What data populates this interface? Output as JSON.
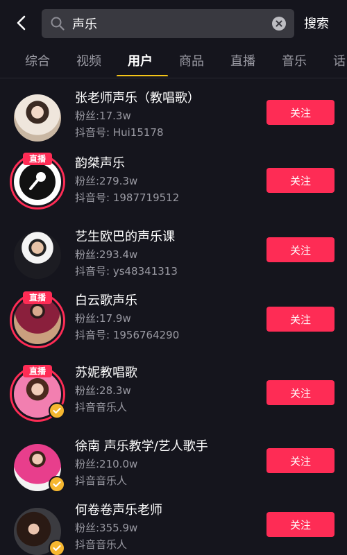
{
  "header": {
    "search_value": "声乐",
    "search_button_label": "搜索"
  },
  "tabs": [
    {
      "label": "综合"
    },
    {
      "label": "视频"
    },
    {
      "label": "用户"
    },
    {
      "label": "商品"
    },
    {
      "label": "直播"
    },
    {
      "label": "音乐"
    },
    {
      "label": "话"
    }
  ],
  "active_tab": "用户",
  "accent_colors": {
    "follow_button": "#fe2c55",
    "tab_underline": "#f5c518",
    "verified_badge": "#f6b730"
  },
  "live_badge_label": "直播",
  "users": [
    {
      "name": "张老师声乐（教唱歌）",
      "fans": "粉丝:17.3w",
      "subline": "抖音号: Hui15178",
      "live": false,
      "verified": false,
      "follow_label": "关注"
    },
    {
      "name": "韵桀声乐",
      "fans": "粉丝:279.3w",
      "subline": "抖音号: 1987719512",
      "live": true,
      "verified": false,
      "follow_label": "关注"
    },
    {
      "name": "艺生欧巴的声乐课",
      "fans": "粉丝:293.4w",
      "subline": "抖音号: ys48341313",
      "live": false,
      "verified": false,
      "follow_label": "关注"
    },
    {
      "name": "白云歌声乐",
      "fans": "粉丝:17.9w",
      "subline": "抖音号: 1956764290",
      "live": true,
      "verified": false,
      "follow_label": "关注"
    },
    {
      "name": "苏妮教唱歌",
      "fans": "粉丝:28.3w",
      "subline": "抖音音乐人",
      "live": true,
      "verified": true,
      "follow_label": "关注"
    },
    {
      "name": "徐南 声乐教学/艺人歌手",
      "fans": "粉丝:210.0w",
      "subline": "抖音音乐人",
      "live": false,
      "verified": true,
      "follow_label": "关注"
    },
    {
      "name": "何卷卷声乐老师",
      "fans": "粉丝:355.9w",
      "subline": "抖音音乐人",
      "live": false,
      "verified": true,
      "follow_label": "关注"
    }
  ]
}
